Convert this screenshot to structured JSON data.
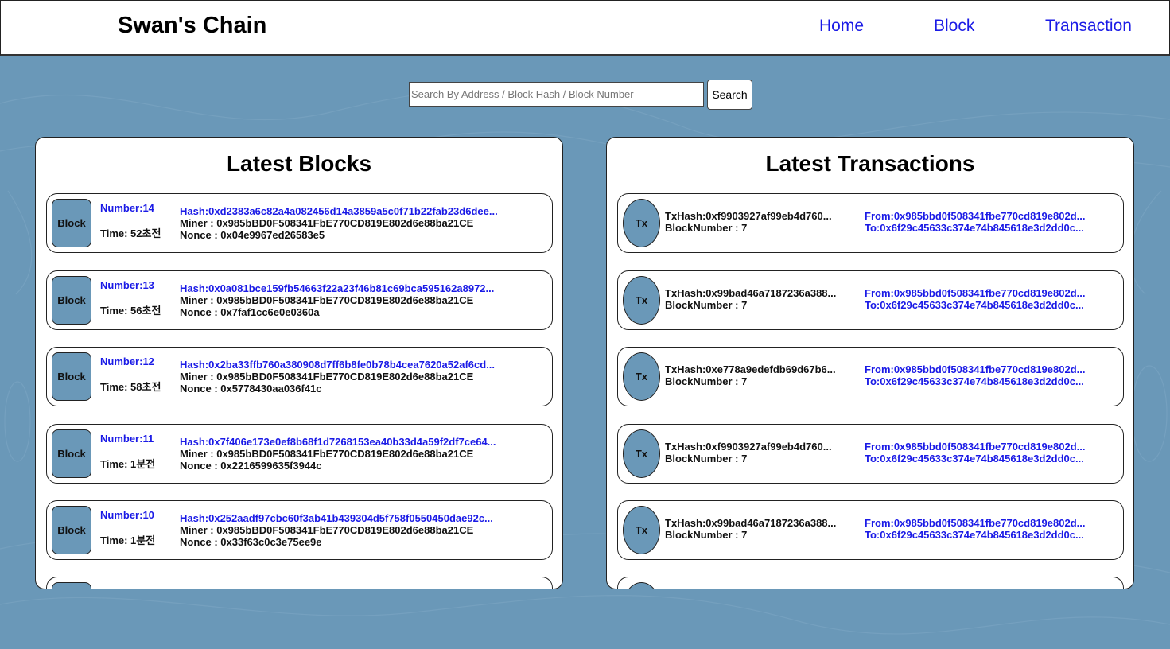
{
  "header": {
    "brand": "Swan's Chain",
    "nav": [
      "Home",
      "Block",
      "Transaction"
    ]
  },
  "search": {
    "placeholder": "Search By Address / Block Hash / Block Number",
    "button_label": "Search"
  },
  "blocks_panel": {
    "title": "Latest Blocks",
    "badge_label": "Block",
    "items": [
      {
        "number": "Number:14",
        "time": "Time: 52초전",
        "hash": "Hash:0xd2383a6c82a4a082456d14a3859a5c0f71b22fab23d6dee...",
        "miner": "Miner : 0x985bBD0F508341FbE770CD819E802d6e88ba21CE",
        "nonce": "Nonce : 0x04e9967ed26583e5"
      },
      {
        "number": "Number:13",
        "time": "Time: 56초전",
        "hash": "Hash:0x0a081bce159fb54663f22a23f46b81c69bca595162a8972...",
        "miner": "Miner : 0x985bBD0F508341FbE770CD819E802d6e88ba21CE",
        "nonce": "Nonce : 0x7faf1cc6e0e0360a"
      },
      {
        "number": "Number:12",
        "time": "Time: 58초전",
        "hash": "Hash:0x2ba33ffb760a380908d7ff6b8fe0b78b4cea7620a52af6cd...",
        "miner": "Miner : 0x985bBD0F508341FbE770CD819E802d6e88ba21CE",
        "nonce": "Nonce : 0x5778430aa036f41c"
      },
      {
        "number": "Number:11",
        "time": "Time: 1분전",
        "hash": "Hash:0x7f406e173e0ef8b68f1d7268153ea40b33d4a59f2df7ce64...",
        "miner": "Miner : 0x985bBD0F508341FbE770CD819E802d6e88ba21CE",
        "nonce": "Nonce : 0x2216599635f3944c"
      },
      {
        "number": "Number:10",
        "time": "Time: 1분전",
        "hash": "Hash:0x252aadf97cbc60f3ab41b439304d5f758f0550450dae92c...",
        "miner": "Miner : 0x985bBD0F508341FbE770CD819E802d6e88ba21CE",
        "nonce": "Nonce : 0x33f63c0c3e75ee9e"
      }
    ]
  },
  "tx_panel": {
    "title": "Latest Transactions",
    "badge_label": "Tx",
    "items": [
      {
        "txhash": "TxHash:0xf9903927af99eb4d760...",
        "block": "BlockNumber : 7",
        "from": "From:0x985bbd0f508341fbe770cd819e802d...",
        "to": "To:0x6f29c45633c374e74b845618e3d2dd0c..."
      },
      {
        "txhash": "TxHash:0x99bad46a7187236a388...",
        "block": "BlockNumber : 7",
        "from": "From:0x985bbd0f508341fbe770cd819e802d...",
        "to": "To:0x6f29c45633c374e74b845618e3d2dd0c..."
      },
      {
        "txhash": "TxHash:0xe778a9edefdb69d67b6...",
        "block": "BlockNumber : 7",
        "from": "From:0x985bbd0f508341fbe770cd819e802d...",
        "to": "To:0x6f29c45633c374e74b845618e3d2dd0c..."
      },
      {
        "txhash": "TxHash:0xf9903927af99eb4d760...",
        "block": "BlockNumber : 7",
        "from": "From:0x985bbd0f508341fbe770cd819e802d...",
        "to": "To:0x6f29c45633c374e74b845618e3d2dd0c..."
      },
      {
        "txhash": "TxHash:0x99bad46a7187236a388...",
        "block": "BlockNumber : 7",
        "from": "From:0x985bbd0f508341fbe770cd819e802d...",
        "to": "To:0x6f29c45633c374e74b845618e3d2dd0c..."
      }
    ]
  },
  "colors": {
    "background": "#6a98b8",
    "link": "#1a1ae6",
    "badge": "#6a98b8"
  }
}
